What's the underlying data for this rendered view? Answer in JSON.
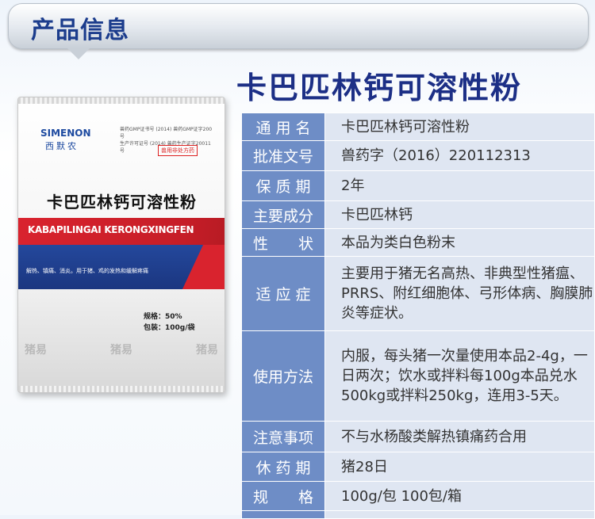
{
  "header": {
    "title": "产品信息"
  },
  "product": {
    "title": "卡巴匹林钙可溶性粉"
  },
  "package": {
    "brand": "SIMENON",
    "brand_cn": "西默农",
    "approval_lines": [
      "兽药GMP证书号 (2014) 兽药GMP证字200号",
      "生产许可证号 (2014) 兽药生产证字20011号"
    ],
    "tag": "兽用非处方药",
    "name": "卡巴匹林钙可溶性粉",
    "pinyin": "KABAPILINGAI KERONGXINGFEN",
    "indications": "解热、镇痛、消炎。用于猪、鸡的发热和缓解疼痛",
    "spec_lines": [
      "规格：50%",
      "包装：100g/袋"
    ],
    "logos": [
      "猪易",
      "猪易",
      "猪易"
    ]
  },
  "specs": [
    {
      "label": "通 用 名",
      "value": "卡巴匹林钙可溶性粉"
    },
    {
      "label": "批准文号",
      "value": "兽药字（2016）220112313"
    },
    {
      "label": "保 质 期",
      "value": "2年"
    },
    {
      "label": "主要成分",
      "value": "卡巴匹林钙"
    },
    {
      "label": "性　　状",
      "value": "本品为类白色粉末"
    },
    {
      "label": "适 应 症",
      "value": "主要用于猪无名高热、非典型性猪瘟、PRRS、附红细胞体、弓形体病、胸膜肺炎等症状。"
    },
    {
      "label": "使用方法",
      "value": "内服，每头猪一次量使用本品2-4g，一日两次；饮水或拌料每100g本品兑水500kg或拌料250kg，连用3-5天。"
    },
    {
      "label": "注意事项",
      "value": "不与水杨酸类解热镇痛药合用"
    },
    {
      "label": "休 药 期",
      "value": "猪28日"
    },
    {
      "label": "规　　格",
      "value": "100g/包 100包/箱"
    },
    {
      "label": "",
      "value": ""
    }
  ],
  "colors": {
    "label_bg": "#6e8dc6",
    "value_bg": "#dfe6f2",
    "title": "#1c2f86"
  }
}
